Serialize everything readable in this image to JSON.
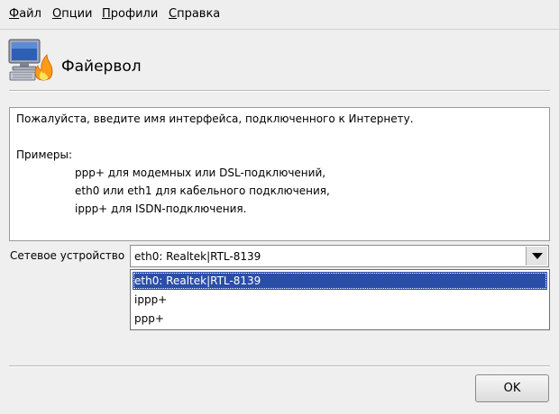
{
  "menubar": {
    "items": [
      {
        "mnemonic": "Ф",
        "rest": "айл"
      },
      {
        "mnemonic": "О",
        "rest": "пции"
      },
      {
        "mnemonic": "П",
        "rest": "рофили"
      },
      {
        "mnemonic": "С",
        "rest": "правка"
      }
    ]
  },
  "header": {
    "title": "Файервол",
    "icon": "computer-with-flame-icon"
  },
  "info": {
    "intro": "Пожалуйста, введите имя интерфейса, подключенного к Интернету.",
    "examples_heading": "Примеры:",
    "examples": [
      "ppp+ для модемных или DSL-подключений,",
      "eth0 или eth1 для кабельного подключения,",
      "ippp+ для ISDN-подключения."
    ]
  },
  "device": {
    "label": "Сетевое устройство",
    "selected": "eth0: Realtek|RTL-8139",
    "options": [
      "eth0: Realtek|RTL-8139",
      "ippp+",
      "ppp+"
    ]
  },
  "footer": {
    "ok_label": "OK"
  },
  "colors": {
    "selection": "#2a4da8",
    "window_bg": "#efefef"
  }
}
